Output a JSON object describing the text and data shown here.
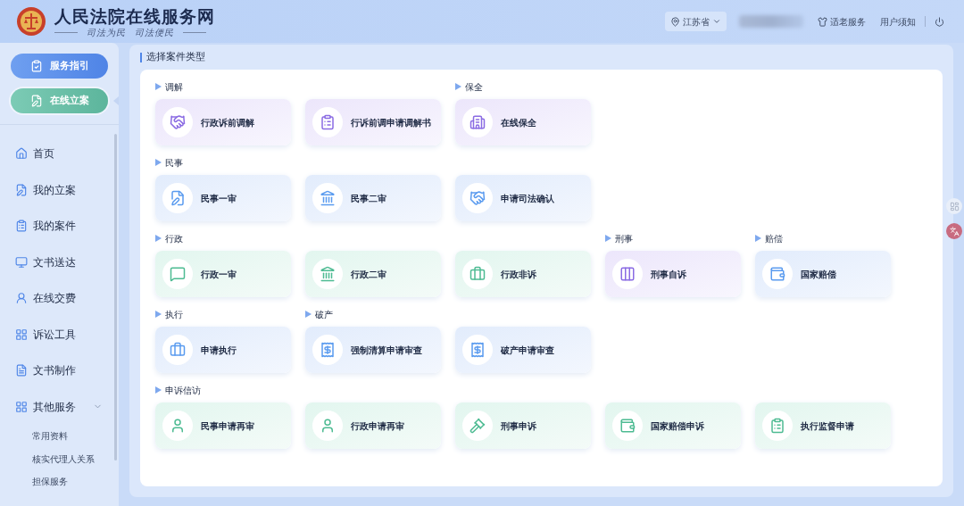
{
  "header": {
    "title": "人民法院在线服务网",
    "mottos": [
      "司法为民",
      "司法便民"
    ],
    "location": "江苏省",
    "links": [
      {
        "kind": "elderly",
        "label": "适老服务"
      },
      {
        "kind": "plain",
        "label": "用户须知"
      }
    ]
  },
  "sidebar": {
    "nav_buttons": [
      {
        "label": "服务指引",
        "kind": "guide",
        "selected": false
      },
      {
        "label": "在线立案",
        "kind": "filing",
        "selected": true
      }
    ],
    "menu": [
      {
        "label": "首页"
      },
      {
        "label": "我的立案"
      },
      {
        "label": "我的案件"
      },
      {
        "label": "文书送达"
      },
      {
        "label": "在线交费"
      },
      {
        "label": "诉讼工具"
      },
      {
        "label": "文书制作"
      },
      {
        "label": "其他服务",
        "expanded": true,
        "children": [
          {
            "label": "常用资料"
          },
          {
            "label": "核实代理人关系"
          },
          {
            "label": "担保服务"
          }
        ]
      }
    ]
  },
  "main": {
    "title": "选择案件类型",
    "rows": [
      [
        {
          "title": "调解",
          "cards": [
            {
              "label": "行政诉前调解"
            },
            {
              "label": "行诉前调申请调解书"
            }
          ]
        },
        {
          "title": "保全",
          "cards": [
            {
              "label": "在线保全"
            }
          ]
        }
      ],
      [
        {
          "title": "民事",
          "cards": [
            {
              "label": "民事一审"
            },
            {
              "label": "民事二审"
            },
            {
              "label": "申请司法确认"
            }
          ]
        }
      ],
      [
        {
          "title": "行政",
          "cards": [
            {
              "label": "行政一审"
            },
            {
              "label": "行政二审"
            },
            {
              "label": "行政非诉"
            }
          ]
        },
        {
          "title": "刑事",
          "cards": [
            {
              "label": "刑事自诉"
            }
          ]
        },
        {
          "title": "赔偿",
          "cards": [
            {
              "label": "国家赔偿"
            }
          ]
        }
      ],
      [
        {
          "title": "执行",
          "cards": [
            {
              "label": "申请执行"
            }
          ]
        },
        {
          "title": "破产",
          "cards": [
            {
              "label": "强制清算申请审查"
            },
            {
              "label": "破产申请审查"
            }
          ]
        }
      ],
      [
        {
          "title": "申诉信访",
          "cards": [
            {
              "label": "民事申请再审"
            },
            {
              "label": "行政申请再审"
            },
            {
              "label": "刑事申诉"
            },
            {
              "label": "国家赔偿申诉"
            },
            {
              "label": "执行监督申请"
            }
          ]
        }
      ]
    ]
  }
}
